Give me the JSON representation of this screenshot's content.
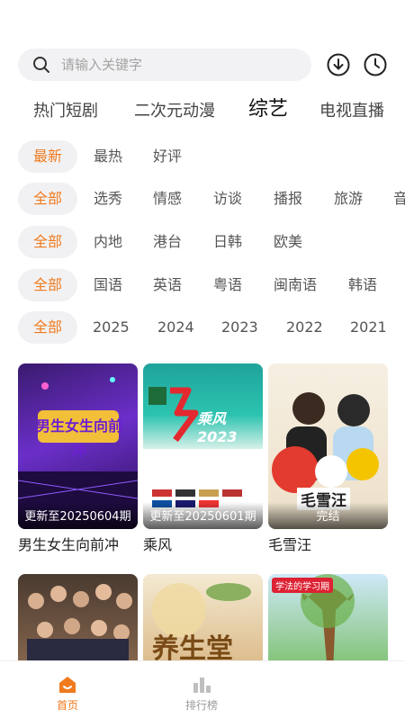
{
  "search": {
    "placeholder": "请输入关键字"
  },
  "header_icons": [
    "download-icon",
    "history-clock-icon"
  ],
  "tabs": [
    {
      "label": "热门短剧"
    },
    {
      "label": "二次元动漫"
    },
    {
      "label": "综艺",
      "active": true
    },
    {
      "label": "电视直播"
    }
  ],
  "filters": {
    "sort": [
      "最新",
      "最热",
      "好评"
    ],
    "genre": [
      "全部",
      "选秀",
      "情感",
      "访谈",
      "播报",
      "旅游",
      "音"
    ],
    "region": [
      "全部",
      "内地",
      "港台",
      "日韩",
      "欧美"
    ],
    "language": [
      "全部",
      "国语",
      "英语",
      "粤语",
      "闽南语",
      "韩语"
    ],
    "year": [
      "全部",
      "2025",
      "2024",
      "2023",
      "2022",
      "2021"
    ]
  },
  "cards": [
    {
      "title": "男生女生向前冲",
      "status": "更新至20250604期",
      "poster_text": "男生女生向前冲"
    },
    {
      "title": "乘风",
      "status": "更新至20250601期",
      "poster_text": "乘风2023"
    },
    {
      "title": "毛雪汪",
      "status": "完结",
      "poster_text": "毛雪汪"
    }
  ],
  "cards_row2": [
    {
      "poster_text": ""
    },
    {
      "poster_text": "养生堂"
    },
    {
      "poster_text": "学法的学习期"
    }
  ],
  "bottom_nav": [
    {
      "label": "首页",
      "icon": "home-icon",
      "active": true
    },
    {
      "label": "排行榜",
      "icon": "ranking-icon",
      "active": false
    }
  ],
  "colors": {
    "accent": "#f07a1e",
    "chip_bg": "#f1f1f3"
  }
}
